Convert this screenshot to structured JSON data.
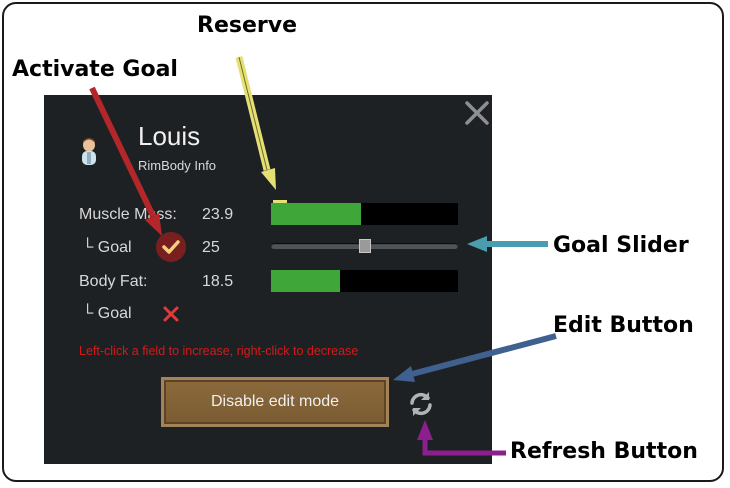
{
  "callouts": {
    "reserve": "Reserve",
    "activate_goal": "Activate Goal",
    "goal_slider": "Goal Slider",
    "edit_button": "Edit Button",
    "refresh_button": "Refresh Button"
  },
  "panel": {
    "pawn_name": "Louis",
    "subtitle": "RimBody Info",
    "rows": {
      "muscle_label": "Muscle Mass:",
      "muscle_value": "23.9",
      "muscle_fill": 0.48,
      "muscle_goal_label": "└ Goal",
      "muscle_goal_value": "25",
      "muscle_goal_active": true,
      "muscle_goal_slider": 0.5,
      "fat_label": "Body Fat:",
      "fat_value": "18.5",
      "fat_fill": 0.37,
      "fat_goal_label": "└ Goal",
      "fat_goal_active": false
    },
    "hint": "Left-click a field to increase, right-click to decrease",
    "edit_button_label": "Disable edit mode",
    "icons": [
      "close-icon",
      "pawn-portrait-icon",
      "checkmark-icon",
      "x-mark-icon",
      "refresh-icon"
    ]
  },
  "colors": {
    "panel_bg": "#1e2124",
    "bar_fill": "#3fa63a",
    "hint": "#d11b1b",
    "reserve": "#e5e074",
    "activate_arrow": "#b3272a",
    "slider_arrow": "#4a9cb0",
    "edit_arrow": "#40608f",
    "refresh_arrow": "#8b1f8e"
  }
}
